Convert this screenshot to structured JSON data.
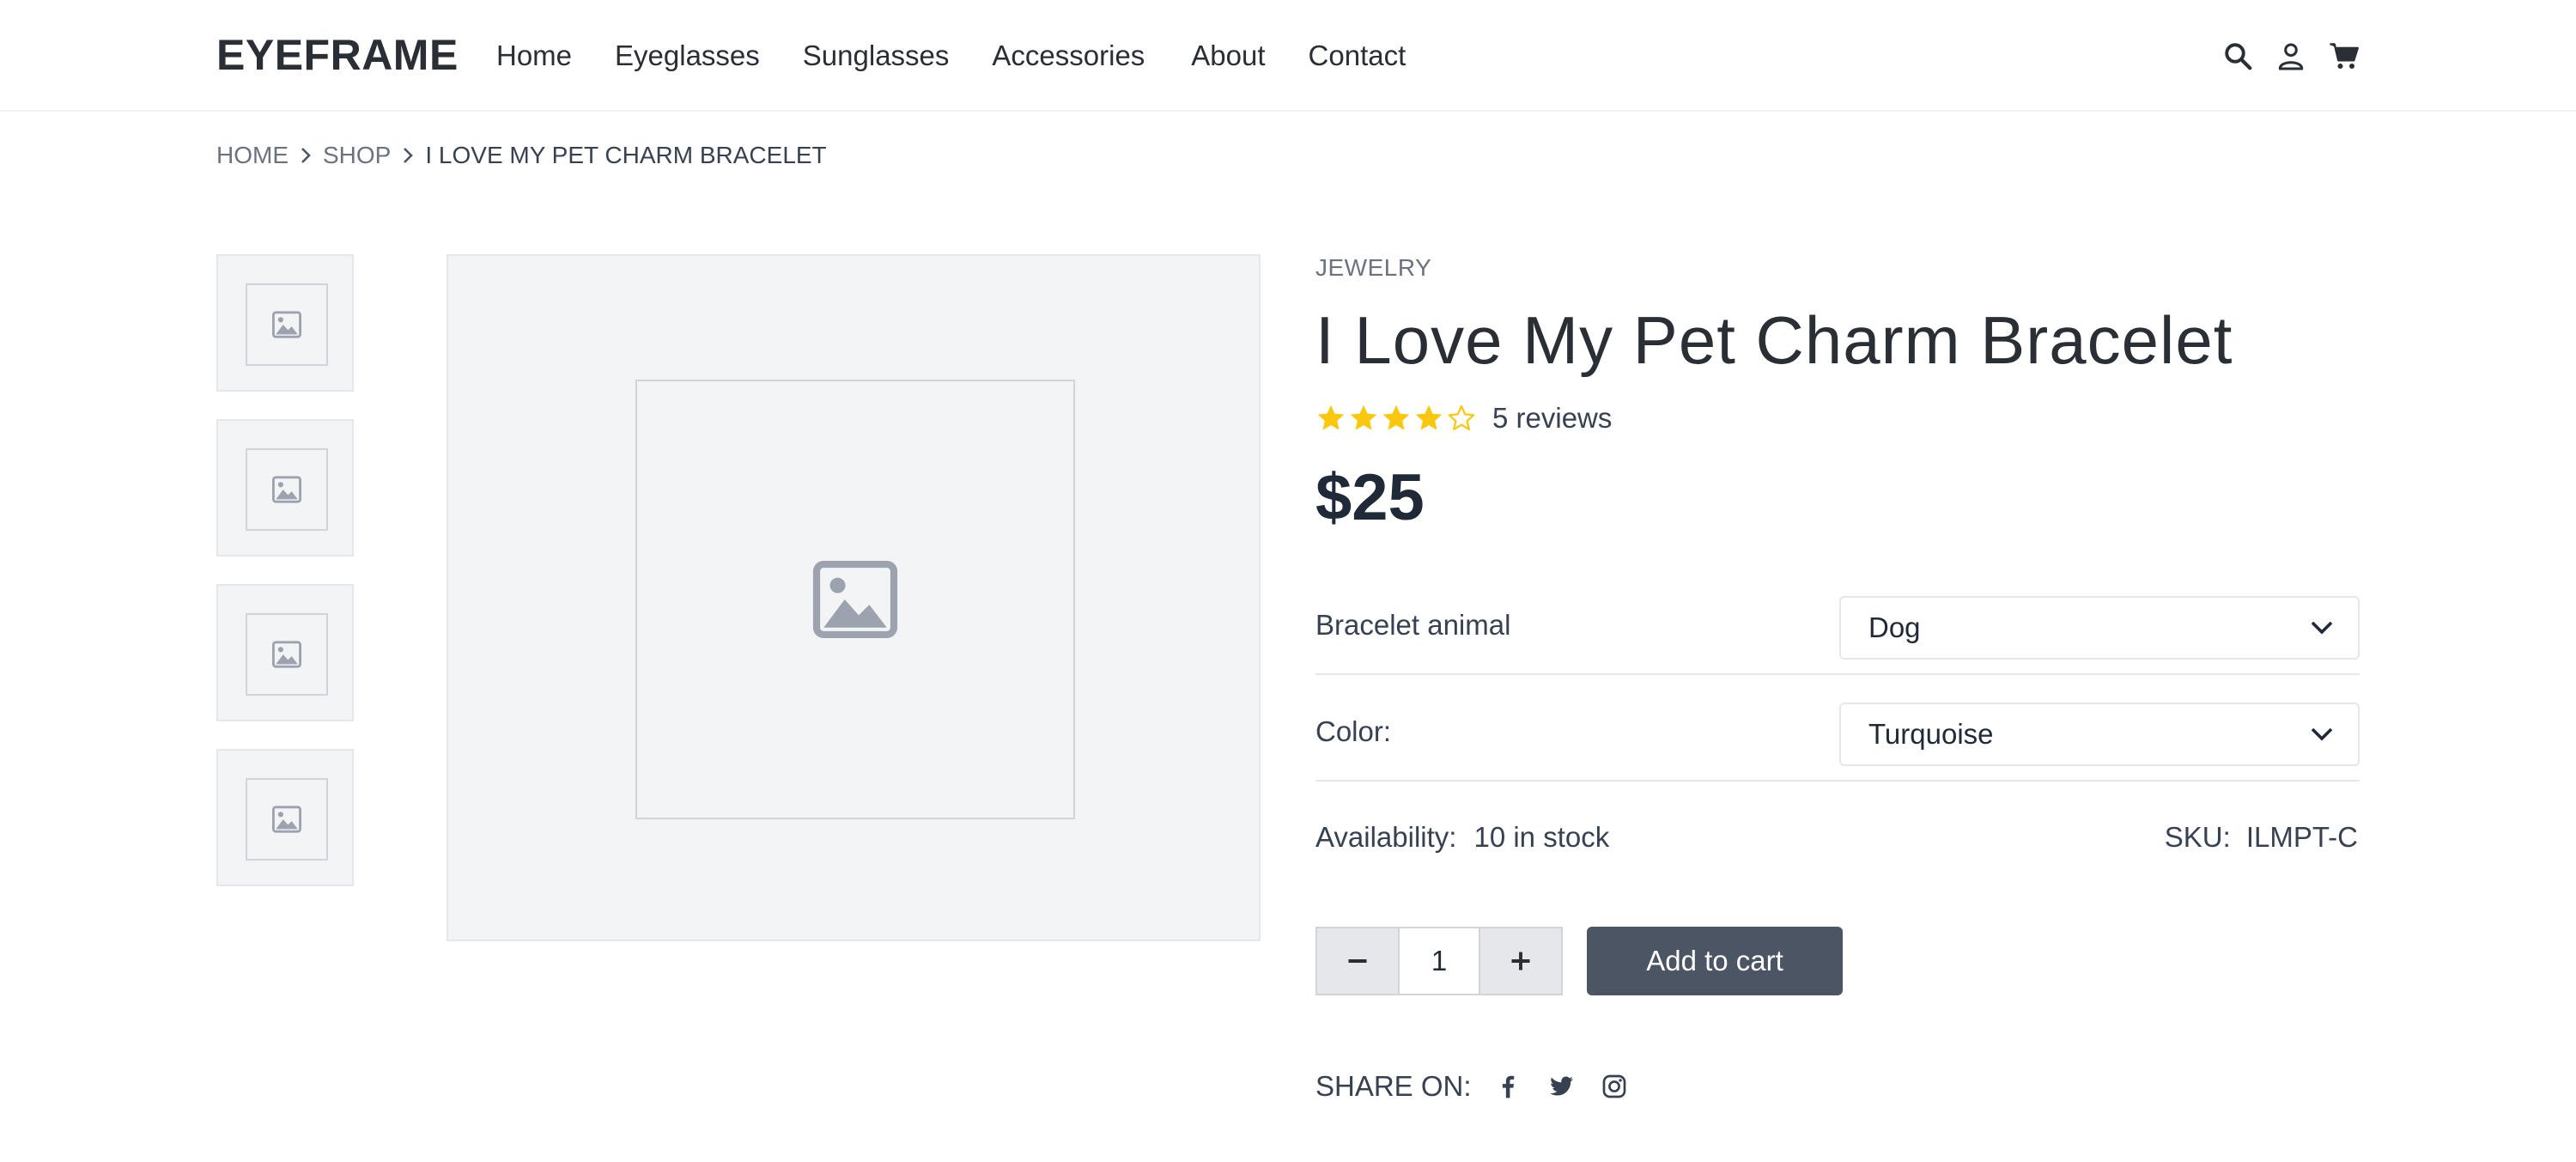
{
  "header": {
    "logo": "EYEFRAME",
    "nav": [
      "Home",
      "Eyeglasses",
      "Sunglasses",
      "Accessories",
      "About",
      "Contact"
    ],
    "icons": [
      "search-icon",
      "user-icon",
      "cart-icon"
    ]
  },
  "breadcrumb": [
    "HOME",
    "SHOP",
    "I LOVE MY PET CHARM BRACELET"
  ],
  "gallery": {
    "thumb_icon": "image-placeholder-icon",
    "main_icon": "image-placeholder-icon"
  },
  "product": {
    "category": "JEWELRY",
    "title": "I Love My Pet Charm Bracelet",
    "rating": 4,
    "rating_max": 5,
    "reviews": "5 reviews",
    "price": "$25",
    "options": [
      {
        "label": "Bracelet animal",
        "value": "Dog"
      },
      {
        "label": "Color:",
        "value": "Turquoise"
      }
    ],
    "availability_label": "Availability:",
    "availability_value": "10 in stock",
    "sku_label": "SKU:",
    "sku_value": "ILMPT-C",
    "quantity": "1",
    "add_to_cart": "Add to cart",
    "share_label": "SHARE ON:",
    "share_icons": [
      "facebook-icon",
      "twitter-icon",
      "instagram-icon"
    ]
  },
  "colors": {
    "star": "#f9c80e",
    "button": "#4b5563",
    "text": "#1f2937",
    "muted": "#6b7280",
    "placeholder_bg": "#f3f4f6"
  }
}
